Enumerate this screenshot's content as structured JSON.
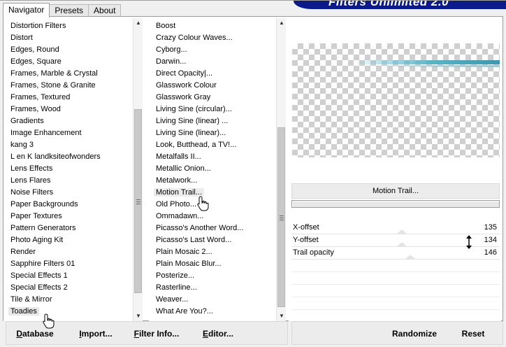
{
  "app": {
    "banner_title": "Filters Unlimited 2.0"
  },
  "tabs": [
    {
      "label": "Navigator",
      "active": true
    },
    {
      "label": "Presets",
      "active": false
    },
    {
      "label": "About",
      "active": false
    }
  ],
  "categories": [
    "Distortion Filters",
    "Distort",
    "Edges, Round",
    "Edges, Square",
    "Frames, Marble & Crystal",
    "Frames, Stone & Granite",
    "Frames, Textured",
    "Frames, Wood",
    "Gradients",
    "Image Enhancement",
    "kang 3",
    "L en K landksiteofwonders",
    "Lens Effects",
    "Lens Flares",
    "Noise Filters",
    "Paper Backgrounds",
    "Paper Textures",
    "Pattern Generators",
    "Photo Aging Kit",
    "Render",
    "Sapphire Filters 01",
    "Special Effects 1",
    "Special Effects 2",
    "Tile & Mirror",
    "Toadies"
  ],
  "selected_category": "Toadies",
  "filters": [
    "Boost",
    "Crazy Colour Waves...",
    "Cyborg...",
    "Darwin...",
    "Direct Opacity|...",
    "Glasswork Colour",
    "Glasswork Gray",
    "Living Sine (circular)...",
    "Living Sine (linear) ...",
    "Living Sine (linear)...",
    "Look, Butthead, a TV!...",
    "Metalfalls II...",
    "Metallic Onion...",
    "Metalwork...",
    "Motion Trail...",
    "Old Photo...",
    "Ommadawn...",
    "Picasso's Another Word...",
    "Picasso's Last Word...",
    "Plain Mosaic 2...",
    "Plain Mosaic Blur...",
    "Posterize...",
    "Rasterline...",
    "Weaver...",
    "What Are You?..."
  ],
  "selected_filter": "Motion Trail...",
  "parameters": [
    {
      "label": "X-offset",
      "value": "135",
      "level": 0.53
    },
    {
      "label": "Y-offset",
      "value": "134",
      "level": 0.53
    },
    {
      "label": "Trail opacity",
      "value": "146",
      "level": 0.57
    }
  ],
  "buttons": {
    "database": "Database",
    "database_key": "D",
    "import": "Import...",
    "import_key": "I",
    "filter_info": "Filter Info...",
    "filter_info_key": "F",
    "editor": "Editor...",
    "editor_key": "E",
    "randomize": "Randomize",
    "reset": "Reset"
  },
  "colors": {
    "banner": "#0a1a8c",
    "trail": "#54b4c8"
  }
}
